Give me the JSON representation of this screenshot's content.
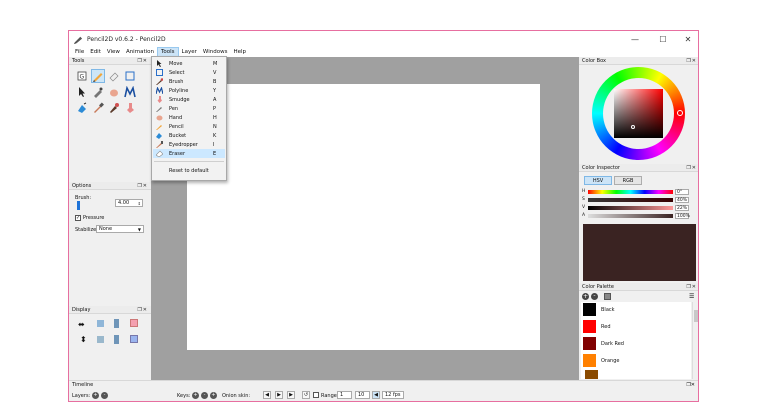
{
  "window": {
    "title": "Pencil2D v0.6.2 - Pencil2D"
  },
  "menu": [
    "File",
    "Edit",
    "View",
    "Animation",
    "Tools",
    "Layer",
    "Windows",
    "Help"
  ],
  "tools_menu": {
    "items": [
      {
        "label": "Move",
        "key": "M"
      },
      {
        "label": "Select",
        "key": "V"
      },
      {
        "label": "Brush",
        "key": "B"
      },
      {
        "label": "Polyline",
        "key": "Y"
      },
      {
        "label": "Smudge",
        "key": "A"
      },
      {
        "label": "Pen",
        "key": "P"
      },
      {
        "label": "Hand",
        "key": "H"
      },
      {
        "label": "Pencil",
        "key": "N"
      },
      {
        "label": "Bucket",
        "key": "K"
      },
      {
        "label": "Eyedropper",
        "key": "I"
      },
      {
        "label": "Eraser",
        "key": "E"
      }
    ],
    "reset": "Reset to default",
    "highlighted": "Eraser"
  },
  "tools_panel": {
    "title": "Tools"
  },
  "options_panel": {
    "title": "Options",
    "brush_label": "Brush:",
    "brush_value": "4.00",
    "pressure_label": "Pressure",
    "stabilizer_label": "Stabilizer",
    "stabilizer_value": "None"
  },
  "display_panel": {
    "title": "Display"
  },
  "color_box": {
    "title": "Color Box"
  },
  "color_inspector": {
    "title": "Color Inspector",
    "tabs": [
      "HSV",
      "RGB"
    ],
    "rows": [
      {
        "label": "H",
        "value": "0°"
      },
      {
        "label": "S",
        "value": "40%"
      },
      {
        "label": "V",
        "value": "22%"
      },
      {
        "label": "A",
        "value": "100%"
      }
    ],
    "preview_color": "#3a2322"
  },
  "color_palette": {
    "title": "Color Palette",
    "swatches": [
      {
        "name": "Black",
        "color": "#000000"
      },
      {
        "name": "Red",
        "color": "#ff0000"
      },
      {
        "name": "Dark Red",
        "color": "#800000"
      },
      {
        "name": "Orange",
        "color": "#ff8000"
      }
    ]
  },
  "timeline": {
    "title": "Timeline",
    "layers_label": "Layers:",
    "keys_label": "Keys:",
    "onion_label": "Onion skin:",
    "range_label": "Range",
    "range_start": "1",
    "range_end": "10",
    "fps": "12 fps"
  },
  "colors": {
    "accent": "#cce4f7",
    "window_border": "#e76fa0"
  }
}
